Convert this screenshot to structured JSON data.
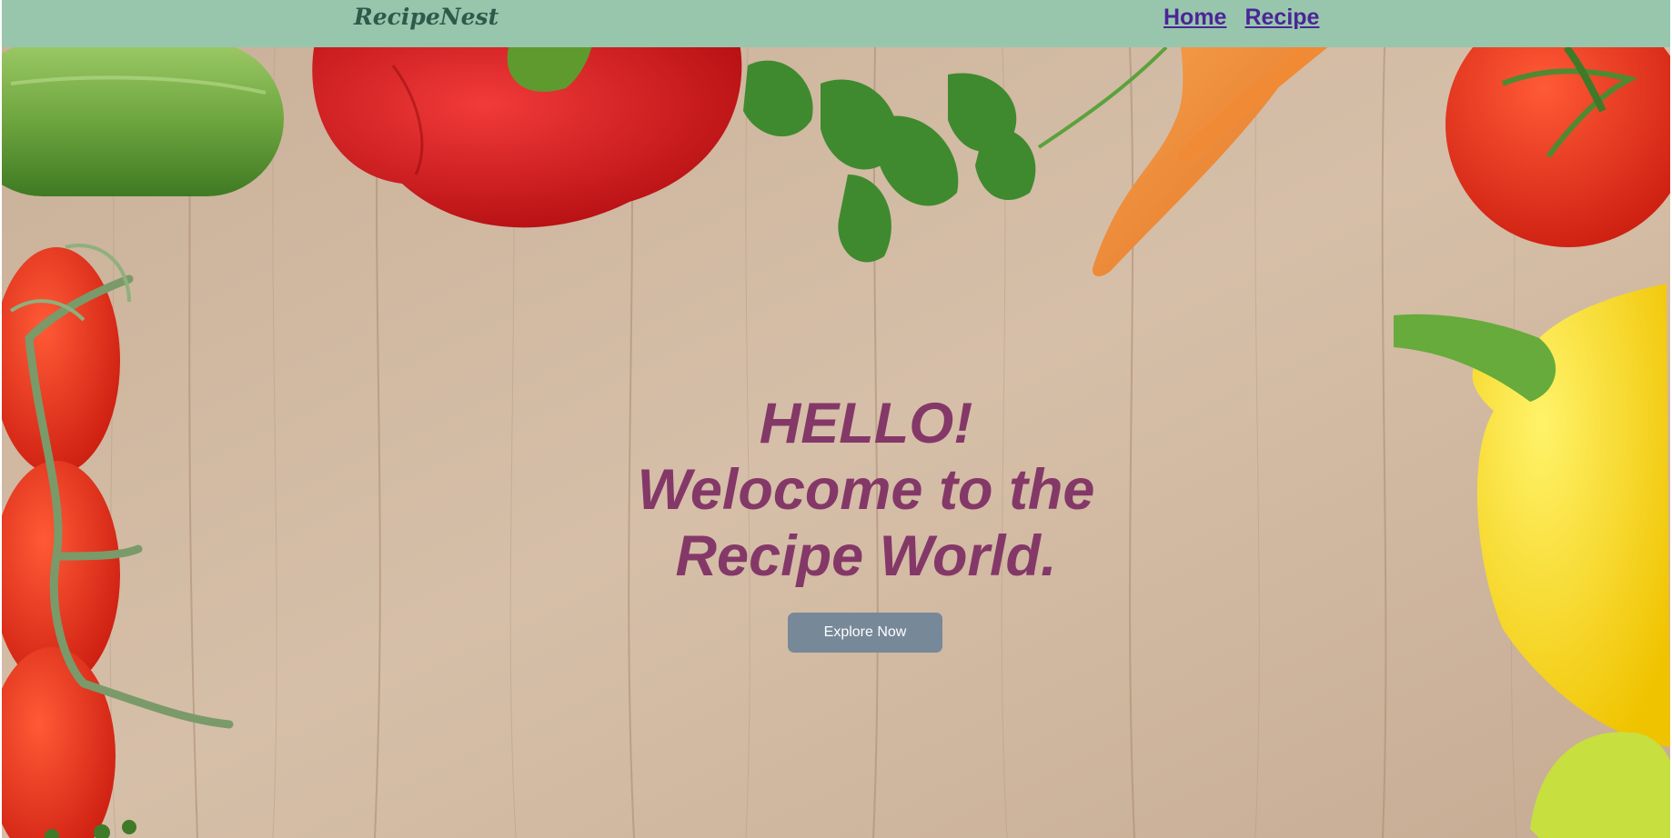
{
  "navbar": {
    "brand": "RecipeNest",
    "links": [
      {
        "label": "Home"
      },
      {
        "label": "Recipe"
      }
    ],
    "background": "#97c6ad",
    "link_color": "#4b2596"
  },
  "hero": {
    "lines": [
      "HELLO!",
      "Welocome to the",
      "Recipe World."
    ],
    "text_color": "#843868",
    "button": {
      "label": "Explore Now",
      "background": "#778899"
    },
    "background_image": "wooden-table-with-vegetables"
  }
}
